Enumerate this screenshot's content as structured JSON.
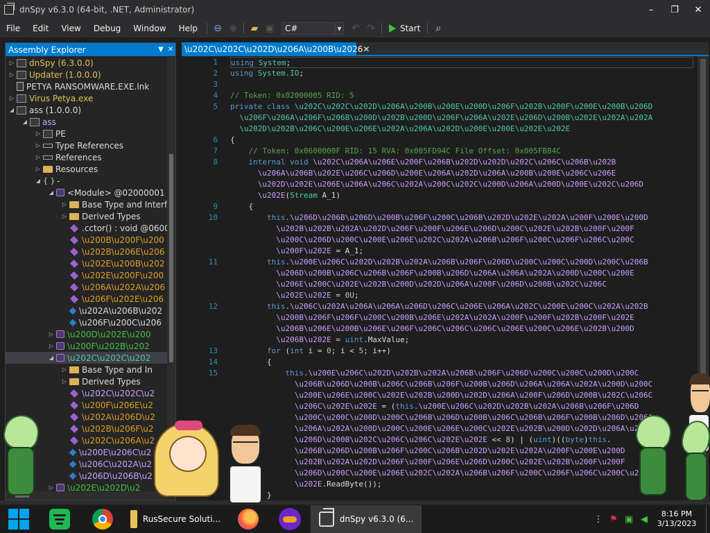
{
  "window": {
    "title": "dnSpy v6.3.0 (64-bit, .NET, Administrator)",
    "min_glyph": "✕",
    "controls": [
      "–",
      "❐",
      "✕"
    ]
  },
  "menu": [
    "File",
    "Edit",
    "View",
    "Debug",
    "Window",
    "Help"
  ],
  "toolbar": {
    "language": "C#",
    "start_label": "Start"
  },
  "explorer": {
    "title": "Assembly Explorer",
    "items": [
      {
        "label": "dnSpy (6.3.0.0)",
        "color": "c-yellow",
        "icon": "asm",
        "tw": "▷",
        "indent": 0
      },
      {
        "label": "Updater (1.0.0.0)",
        "color": "c-yellow",
        "icon": "asm",
        "tw": "▷",
        "indent": 0
      },
      {
        "label": "PETYA RANSOMWARE.EXE.lnk",
        "color": "c-white",
        "icon": "file",
        "tw": "",
        "indent": 0
      },
      {
        "label": "Virus Petya.exe",
        "color": "c-yellow",
        "icon": "asm",
        "tw": "▷",
        "indent": 0
      },
      {
        "label": "ass (1.0.0.0)",
        "color": "c-white",
        "icon": "asm",
        "tw": "◢",
        "indent": 0
      },
      {
        "label": "ass",
        "color": "c-violet",
        "icon": "asm",
        "tw": "◢",
        "indent": 1
      },
      {
        "label": "PE",
        "color": "c-white",
        "icon": "asm",
        "tw": "▷",
        "indent": 2
      },
      {
        "label": "Type References",
        "color": "c-white",
        "icon": "ref",
        "tw": "▷",
        "indent": 2
      },
      {
        "label": "References",
        "color": "c-white",
        "icon": "ref",
        "tw": "▷",
        "indent": 2
      },
      {
        "label": "Resources",
        "color": "c-white",
        "icon": "folder",
        "tw": "▷",
        "indent": 2
      },
      {
        "label": "-",
        "color": "c-white",
        "icon": "ns",
        "tw": "◢",
        "indent": 2
      },
      {
        "label": "<Module> @02000001",
        "color": "c-white",
        "icon": "cls",
        "tw": "◢",
        "indent": 3
      },
      {
        "label": "Base Type and Interf",
        "color": "c-white",
        "icon": "folder",
        "tw": "▷",
        "indent": 4
      },
      {
        "label": "Derived Types",
        "color": "c-white",
        "icon": "folder",
        "tw": "▷",
        "indent": 4
      },
      {
        "label": ".cctor() : void @0600",
        "color": "c-white",
        "icon": "method",
        "tw": "",
        "indent": 4
      },
      {
        "label": "\\u200B\\u200F\\u200",
        "color": "c-orange",
        "icon": "method",
        "tw": "",
        "indent": 4
      },
      {
        "label": "\\u202B\\u206E\\u206",
        "color": "c-orange",
        "icon": "method",
        "tw": "",
        "indent": 4
      },
      {
        "label": "\\u202E\\u200B\\u202",
        "color": "c-orange",
        "icon": "method",
        "tw": "",
        "indent": 4
      },
      {
        "label": "\\u202E\\u200F\\u200",
        "color": "c-orange",
        "icon": "method",
        "tw": "",
        "indent": 4
      },
      {
        "label": "\\u206A\\u202A\\u206",
        "color": "c-orange",
        "icon": "method",
        "tw": "",
        "indent": 4
      },
      {
        "label": "\\u206F\\u202E\\u206",
        "color": "c-orange",
        "icon": "method",
        "tw": "",
        "indent": 4
      },
      {
        "label": "\\u202A\\u206B\\u202",
        "color": "c-white",
        "icon": "field",
        "tw": "",
        "indent": 4
      },
      {
        "label": "\\u206F\\u200C\\u206",
        "color": "c-white",
        "icon": "field",
        "tw": "",
        "indent": 4
      },
      {
        "label": "\\u200D\\u202E\\u200",
        "color": "c-green",
        "icon": "cls",
        "tw": "▷",
        "indent": 3
      },
      {
        "label": "\\u200F\\u202B\\u202",
        "color": "c-green",
        "icon": "cls",
        "tw": "▷",
        "indent": 3
      },
      {
        "label": "\\u202C\\u202C\\u202",
        "color": "c-teal",
        "icon": "cls",
        "tw": "◢",
        "indent": 3,
        "selected": true
      },
      {
        "label": "Base Type and In",
        "color": "c-white",
        "icon": "folder",
        "tw": "▷",
        "indent": 4
      },
      {
        "label": "Derived Types",
        "color": "c-white",
        "icon": "folder",
        "tw": "▷",
        "indent": 4
      },
      {
        "label": "\\u202C\\u202C\\u2",
        "color": "c-violet",
        "icon": "method",
        "tw": "",
        "indent": 4
      },
      {
        "label": "\\u200F\\u206E\\u2",
        "color": "c-orange",
        "icon": "method",
        "tw": "",
        "indent": 4
      },
      {
        "label": "\\u202A\\u206D\\u2",
        "color": "c-orange",
        "icon": "method",
        "tw": "",
        "indent": 4
      },
      {
        "label": "\\u202B\\u206F\\u2",
        "color": "c-orange",
        "icon": "method",
        "tw": "",
        "indent": 4
      },
      {
        "label": "\\u202C\\u206A\\u2",
        "color": "c-orange",
        "icon": "method",
        "tw": "",
        "indent": 4
      },
      {
        "label": "\\u200E\\u206C\\u2",
        "color": "c-violet",
        "icon": "field",
        "tw": "",
        "indent": 4
      },
      {
        "label": "\\u206C\\u202A\\u2",
        "color": "c-violet",
        "icon": "field",
        "tw": "",
        "indent": 4
      },
      {
        "label": "\\u206D\\u206B\\u2",
        "color": "c-violet",
        "icon": "field",
        "tw": "",
        "indent": 4
      },
      {
        "label": "\\u202E\\u202D\\u2",
        "color": "c-green",
        "icon": "cls",
        "tw": "▷",
        "indent": 3
      }
    ]
  },
  "tab": {
    "label": "\\u202C\\u202C\\u202D\\u206A\\u200B\\u2026"
  },
  "code": {
    "line_numbers": [
      {
        "n": "1",
        "row": 0
      },
      {
        "n": "2",
        "row": 1
      },
      {
        "n": "3",
        "row": 2
      },
      {
        "n": "4",
        "row": 3
      },
      {
        "n": "5",
        "row": 4
      },
      {
        "n": "6",
        "row": 7
      },
      {
        "n": "7",
        "row": 8
      },
      {
        "n": "8",
        "row": 9
      },
      {
        "n": "9",
        "row": 13
      },
      {
        "n": "10",
        "row": 14
      },
      {
        "n": "11",
        "row": 18
      },
      {
        "n": "12",
        "row": 22
      },
      {
        "n": "13",
        "row": 26
      },
      {
        "n": "14",
        "row": 27
      },
      {
        "n": "15",
        "row": 28
      },
      {
        "n": "16",
        "row": 38
      }
    ],
    "lines": [
      [
        [
          "k",
          "using"
        ],
        [
          "",
          " "
        ],
        [
          "t",
          "System"
        ],
        [
          "",
          ";"
        ]
      ],
      [
        [
          "k",
          "using"
        ],
        [
          "",
          " "
        ],
        [
          "t",
          "System.IO"
        ],
        [
          "",
          ";"
        ]
      ],
      [],
      [
        [
          "cm",
          "// Token: 0x02000005 RID: 5"
        ]
      ],
      [
        [
          "k",
          "private class"
        ],
        [
          "",
          " "
        ],
        [
          "t",
          "\\u202C\\u202C\\u202D\\u206A\\u200B\\u200E\\u200D\\u206F\\u202B\\u200F\\u200E\\u200B\\u206D"
        ]
      ],
      [
        [
          "t",
          "  \\u206F\\u206A\\u206F\\u206B\\u200D\\u202B\\u200D\\u206F\\u206A\\u202E\\u206D\\u200B\\u202E\\u202A\\u202A"
        ]
      ],
      [
        [
          "t",
          "  \\u202D\\u202B\\u206C\\u200E\\u206E\\u202A\\u206A\\u202D\\u200E\\u200E\\u202E\\u202E"
        ]
      ],
      [
        [
          "",
          "{"
        ]
      ],
      [
        [
          "cm",
          "    // Token: 0x0600000F RID: 15 RVA: 0x005FD94C File Offset: 0x005FB84C"
        ]
      ],
      [
        [
          "k",
          "    internal void"
        ],
        [
          "",
          " "
        ],
        [
          "pr",
          "\\u202C\\u206A\\u206E\\u200F\\u206B\\u202D\\u202D\\u202C\\u206C\\u206B\\u202B"
        ]
      ],
      [
        [
          "pr",
          "      \\u206A\\u206B\\u202E\\u206C\\u206D\\u200E\\u206A\\u202D\\u206A\\u200B\\u200E\\u206C\\u206E"
        ]
      ],
      [
        [
          "pr",
          "      \\u202D\\u202E\\u206E\\u206A\\u206C\\u202A\\u200C\\u202C\\u200D\\u206A\\u200D\\u200E\\u202C\\u206D"
        ]
      ],
      [
        [
          "pr",
          "      \\u202E"
        ],
        [
          "",
          "("
        ],
        [
          "t",
          "Stream"
        ],
        [
          "",
          " A_1)"
        ]
      ],
      [
        [
          "",
          "    {"
        ]
      ],
      [
        [
          "",
          "        "
        ],
        [
          "k",
          "this"
        ],
        [
          "pr",
          ".\\u206D\\u206B\\u206D\\u200B\\u206F\\u200C\\u206B\\u202D\\u202E\\u202A\\u200F\\u200E\\u200D"
        ]
      ],
      [
        [
          "pr",
          "          \\u202B\\u202B\\u202A\\u202D\\u206F\\u200F\\u206E\\u206D\\u200C\\u202E\\u202B\\u200F\\u200F"
        ]
      ],
      [
        [
          "pr",
          "          \\u200C\\u206D\\u200C\\u200E\\u206E\\u202C\\u202A\\u206B\\u206F\\u200C\\u206F\\u206C\\u200C"
        ]
      ],
      [
        [
          "pr",
          "          \\u200F\\u202E"
        ],
        [
          "",
          " = A_1;"
        ]
      ],
      [
        [
          "",
          "        "
        ],
        [
          "k",
          "this"
        ],
        [
          "pr",
          ".\\u200E\\u206C\\u202D\\u202B\\u202A\\u206B\\u206F\\u206D\\u200C\\u200C\\u200D\\u200C\\u206B"
        ]
      ],
      [
        [
          "pr",
          "          \\u206D\\u200B\\u206C\\u206B\\u206F\\u200B\\u206D\\u206A\\u206A\\u202A\\u200D\\u200C\\u200E"
        ]
      ],
      [
        [
          "pr",
          "          \\u206E\\u200C\\u202E\\u202B\\u200D\\u202D\\u206A\\u200F\\u206D\\u200B\\u202C\\u206C"
        ]
      ],
      [
        [
          "pr",
          "          \\u202E\\u202E"
        ],
        [
          "",
          " = "
        ],
        [
          "nm",
          "0U"
        ],
        [
          "",
          ";"
        ]
      ],
      [
        [
          "",
          "        "
        ],
        [
          "k",
          "this"
        ],
        [
          "pr",
          ".\\u206C\\u202A\\u206A\\u206A\\u206D\\u206C\\u206E\\u206A\\u202C\\u200E\\u200C\\u202A\\u202B"
        ]
      ],
      [
        [
          "pr",
          "          \\u200B\\u206F\\u206F\\u200C\\u200B\\u206E\\u202A\\u202A\\u200F\\u200F\\u202B\\u200F\\u202E"
        ]
      ],
      [
        [
          "pr",
          "          \\u206B\\u206E\\u200B\\u206E\\u206F\\u206C\\u206C\\u206C\\u206E\\u200C\\u206E\\u202B\\u200D"
        ]
      ],
      [
        [
          "pr",
          "          \\u206B\\u202E"
        ],
        [
          "",
          " = "
        ],
        [
          "k",
          "uint"
        ],
        [
          "",
          ".MaxValue;"
        ]
      ],
      [
        [
          "",
          "        "
        ],
        [
          "k",
          "for"
        ],
        [
          "",
          " ("
        ],
        [
          "k",
          "int"
        ],
        [
          "",
          " i = "
        ],
        [
          "nm",
          "0"
        ],
        [
          "",
          "; i < "
        ],
        [
          "nm",
          "5"
        ],
        [
          "",
          "; i++)"
        ]
      ],
      [
        [
          "",
          "        {"
        ]
      ],
      [
        [
          "",
          "            "
        ],
        [
          "k",
          "this"
        ],
        [
          "pr",
          ".\\u200E\\u206C\\u202D\\u202B\\u202A\\u206B\\u206F\\u206D\\u200C\\u200C\\u200D\\u200C"
        ]
      ],
      [
        [
          "pr",
          "              \\u206B\\u206D\\u200B\\u206C\\u206B\\u206F\\u200B\\u206D\\u206A\\u206A\\u202A\\u200D\\u200C"
        ]
      ],
      [
        [
          "pr",
          "              \\u200E\\u206E\\u200C\\u202E\\u202B\\u200D\\u202D\\u206A\\u200F\\u206D\\u200B\\u202C\\u206C"
        ]
      ],
      [
        [
          "pr",
          "              \\u206C\\u202E\\u202E"
        ],
        [
          "",
          " = ("
        ],
        [
          "k",
          "this"
        ],
        [
          "pr",
          ".\\u200E\\u206C\\u202D\\u202B\\u202A\\u206B\\u206F\\u206D"
        ]
      ],
      [
        [
          "pr",
          "              \\u200C\\u200C\\u200D\\u200C\\u206B\\u206D\\u200B\\u206C\\u206B\\u206F\\u200B\\u206D\\u206A"
        ]
      ],
      [
        [
          "pr",
          "              \\u206A\\u202A\\u200D\\u200C\\u200E\\u206E\\u200C\\u202E\\u202B\\u200D\\u202D\\u206A\\u200F"
        ]
      ],
      [
        [
          "pr",
          "              \\u206D\\u200B\\u202C\\u206C\\u206C\\u202E\\u202E"
        ],
        [
          "",
          " << "
        ],
        [
          "nm",
          "8"
        ],
        [
          "",
          ") | ("
        ],
        [
          "k",
          "uint"
        ],
        [
          "",
          ")(("
        ],
        [
          "k",
          "byte"
        ],
        [
          "",
          ")"
        ],
        [
          "k",
          "this"
        ],
        [
          "",
          "."
        ]
      ],
      [
        [
          "pr",
          "              \\u206B\\u206D\\u200B\\u206F\\u200C\\u206B\\u202D\\u202E\\u202A\\u200F\\u200E\\u200D"
        ]
      ],
      [
        [
          "pr",
          "              \\u202B\\u202A\\u202D\\u206F\\u200F\\u206E\\u206D\\u200C\\u202E\\u202B\\u200F\\u200F"
        ]
      ],
      [
        [
          "pr",
          "              \\u206D\\u200C\\u200E\\u206E\\u202C\\u202A\\u206B\\u206F\\u200C\\u206F\\u206C\\u200C\\u200F"
        ]
      ],
      [
        [
          "pr",
          "              \\u202E"
        ],
        [
          "",
          ".ReadByte());"
        ]
      ],
      [
        [
          "",
          "        }"
        ]
      ]
    ]
  },
  "taskbar": {
    "apps": [
      {
        "name": "start-button",
        "label": ""
      },
      {
        "name": "spotify-app",
        "label": ""
      },
      {
        "name": "chrome-app",
        "label": ""
      },
      {
        "name": "explorer-app",
        "label": "RusSecure Soluti..."
      },
      {
        "name": "firefox-app",
        "label": ""
      },
      {
        "name": "mask-app",
        "label": ""
      },
      {
        "name": "dnspy-app",
        "label": "dnSpy v6.3.0 (6..."
      }
    ],
    "time": "8:16 PM",
    "date": "3/13/2023"
  }
}
